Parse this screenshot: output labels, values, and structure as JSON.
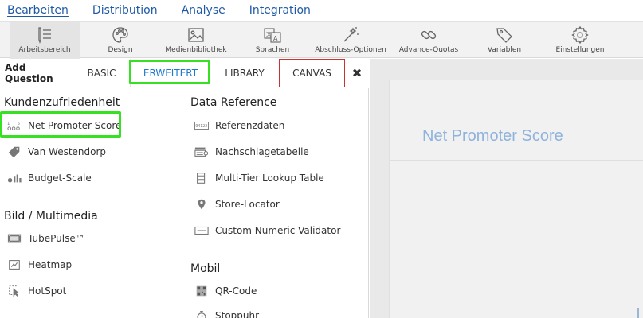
{
  "top_menu": {
    "items": [
      "Bearbeiten",
      "Distribution",
      "Analyse",
      "Integration"
    ],
    "active": "Bearbeiten"
  },
  "toolbar": {
    "items": [
      {
        "label": "Arbeitsbereich",
        "icon": "workspace-icon"
      },
      {
        "label": "Design",
        "icon": "palette-icon"
      },
      {
        "label": "Medienbibliothek",
        "icon": "image-icon"
      },
      {
        "label": "Sprachen",
        "icon": "translate-icon"
      },
      {
        "label": "Abschluss-Optionen",
        "icon": "magic-wand-icon"
      },
      {
        "label": "Advance-Quotas",
        "icon": "link-icon"
      },
      {
        "label": "Variablen",
        "icon": "tag-icon"
      },
      {
        "label": "Einstellungen",
        "icon": "gear-icon"
      }
    ]
  },
  "tabs": {
    "add_question": "Add Question",
    "basic": "BASIC",
    "erweitert": "ERWEITERT",
    "library": "LIBRARY",
    "canvas": "CANVAS",
    "close": "✖"
  },
  "left_column": {
    "kundenzufriedenheit": {
      "heading": "Kundenzufriedenheit",
      "items": [
        "Net Promoter Score",
        "Van Westendorp",
        "Budget-Scale"
      ]
    },
    "bild_multimedia": {
      "heading": "Bild / Multimedia",
      "items": [
        "TubePulse™",
        "Heatmap",
        "HotSpot"
      ]
    }
  },
  "right_column": {
    "data_reference": {
      "heading": "Data Reference",
      "items": [
        "Referenzdaten",
        "Nachschlagetabelle",
        "Multi-Tier Lookup Table",
        "Store-Locator",
        "Custom Numeric Validator"
      ]
    },
    "mobil": {
      "heading": "Mobil",
      "items": [
        "QR-Code",
        "Stoppuhr"
      ]
    }
  },
  "canvas": {
    "question_title": "Net Promoter Score"
  },
  "colors": {
    "accent_blue": "#1f5aa6",
    "highlight_green": "#37e023",
    "canvas_tab_border": "#c9322f",
    "canvas_title": "#8fb3dc"
  }
}
